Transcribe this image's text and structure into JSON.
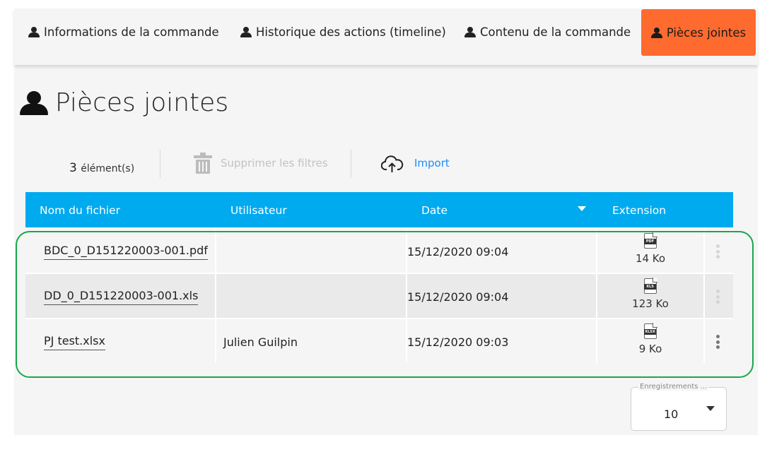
{
  "tabs": [
    {
      "label": "Informations de la commande",
      "active": false,
      "icon": "user-icon"
    },
    {
      "label": "Historique des actions (timeline)",
      "active": false,
      "icon": "user-icon"
    },
    {
      "label": "Contenu de la commande",
      "active": false,
      "icon": "user-icon"
    },
    {
      "label": "Pièces jointes",
      "active": true,
      "icon": "user-icon"
    }
  ],
  "page": {
    "title": "Pièces jointes",
    "title_icon": "user-icon"
  },
  "toolbar": {
    "count": "3",
    "count_label": "élément(s)",
    "clear_filters_label": "Supprimer les filtres",
    "clear_filters_icon": "trash-icon",
    "import_label": "Import",
    "import_icon": "cloud-upload-icon"
  },
  "table": {
    "columns": [
      "Nom du fichier",
      "Utilisateur",
      "Date",
      "Extension"
    ],
    "sort_icon": "sort-desc-caret-icon",
    "rows": [
      {
        "filename": "BDC_0_D151220003-001.pdf",
        "user": "",
        "date": "15/12/2020 09:04",
        "ext_icon": "PDF",
        "size": "14 Ko",
        "menu_enabled": false
      },
      {
        "filename": "DD_0_D151220003-001.xls",
        "user": "",
        "date": "15/12/2020 09:04",
        "ext_icon": "XLS",
        "size": "123 Ko",
        "menu_enabled": false
      },
      {
        "filename": "PJ test.xlsx",
        "user": "Julien Guilpin",
        "date": "15/12/2020 09:03",
        "ext_icon": "XLSX",
        "size": "9 Ko",
        "menu_enabled": true
      }
    ]
  },
  "pager": {
    "label": "Enregistrements ...",
    "value": "10"
  },
  "colors": {
    "accent": "#ff6a2f",
    "header": "#00aaef",
    "link": "#1a8cff",
    "highlight": "#17a84a"
  }
}
